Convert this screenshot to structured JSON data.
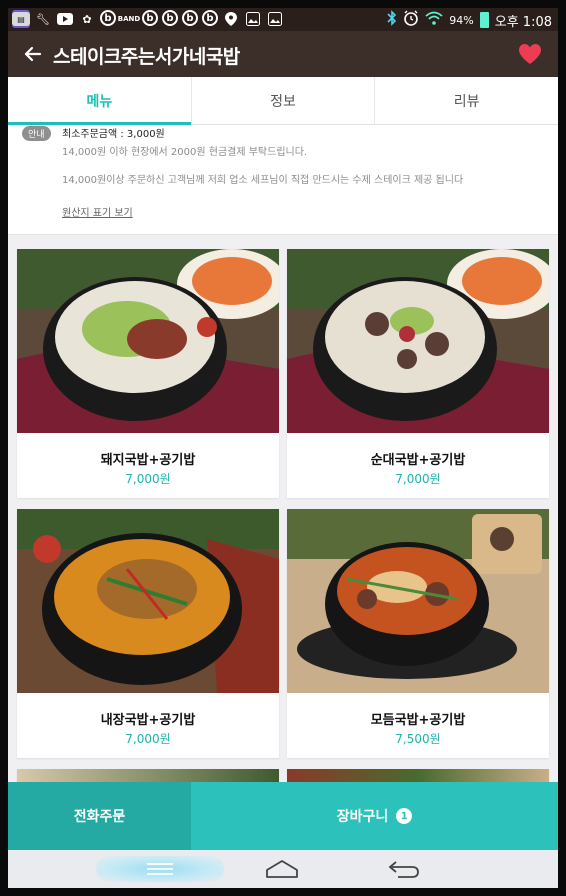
{
  "status": {
    "battery": "94%",
    "time": "오후 1:08",
    "icons": [
      "app-icon",
      "wrench-icon",
      "youtube-icon",
      "flower-icon",
      "b-icon",
      "band-icon",
      "card-icon",
      "b-icon",
      "b-icon",
      "b-icon",
      "b-icon",
      "location-icon",
      "image-icon",
      "image-icon",
      "bluetooth-icon",
      "alarm-icon",
      "wifi-icon",
      "battery-icon"
    ]
  },
  "appbar": {
    "title": "스테이크주는서가네국밥",
    "back_icon": "arrow-left-icon",
    "favorite_icon": "heart-icon",
    "favorite_color": "#ee3d52"
  },
  "tabs": [
    {
      "label": "메뉴",
      "active": true
    },
    {
      "label": "정보",
      "active": false
    },
    {
      "label": "리뷰",
      "active": false
    }
  ],
  "notice": {
    "badge": "안내",
    "min_order": "최소주문금액 : 3,000원",
    "line1": "14,000원 이하 현장에서 2000원 현금결제 부탁드립니다.",
    "line2": "14,000원이상 주문하신 고객님께 저희 업소 세프님이 직접 만드시는 수제 스테이크 제공 됩니다",
    "origin_link": "원산지 표기 보기"
  },
  "menu": [
    {
      "name": "돼지국밥+공기밥",
      "price": "7,000원"
    },
    {
      "name": "순대국밥+공기밥",
      "price": "7,000원"
    },
    {
      "name": "내장국밥+공기밥",
      "price": "7,000원"
    },
    {
      "name": "모듬국밥+공기밥",
      "price": "7,500원"
    }
  ],
  "actions": {
    "call": "전화주문",
    "cart": "장바구니",
    "cart_count": "1"
  },
  "colors": {
    "accent": "#1fbfb8",
    "appbar": "#3c2f29",
    "statusbar": "#2b1f1b",
    "price": "#1fb3ae"
  }
}
